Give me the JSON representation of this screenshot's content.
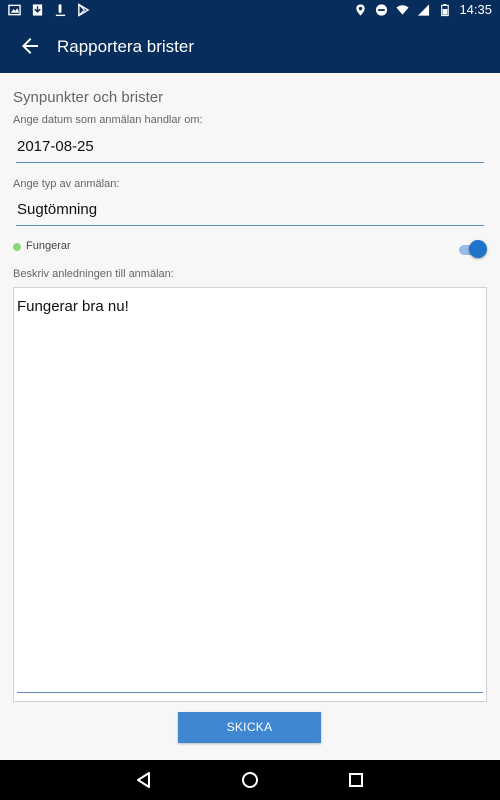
{
  "status_bar": {
    "time": "14:35",
    "icons_left": [
      "image-icon",
      "download-icon",
      "underscore-icon",
      "play-store-icon"
    ],
    "icons_right": [
      "location-icon",
      "dnd-icon",
      "wifi-icon",
      "signal-icon",
      "battery-icon"
    ]
  },
  "app_bar": {
    "title": "Rapportera brister",
    "back_icon": "arrow-back-icon"
  },
  "form": {
    "section_title": "Synpunkter och brister",
    "date_label": "Ange datum som anmälan handlar om:",
    "date_value": "2017-08-25",
    "type_label": "Ange typ av anmälan:",
    "type_value": "Sugtömning",
    "status_label": "Fungerar",
    "status_on": true,
    "description_label": "Beskriv anledningen till anmälan:",
    "description_value": "Fungerar bra nu!",
    "submit_label": "SKICKA"
  },
  "colors": {
    "primary": "#062d5b",
    "accent": "#1f73c9",
    "button": "#3f87d0",
    "status_dot": "#8cd57b"
  },
  "nav_bar": {
    "icons": [
      "back-triangle-icon",
      "home-circle-icon",
      "recents-square-icon"
    ]
  }
}
